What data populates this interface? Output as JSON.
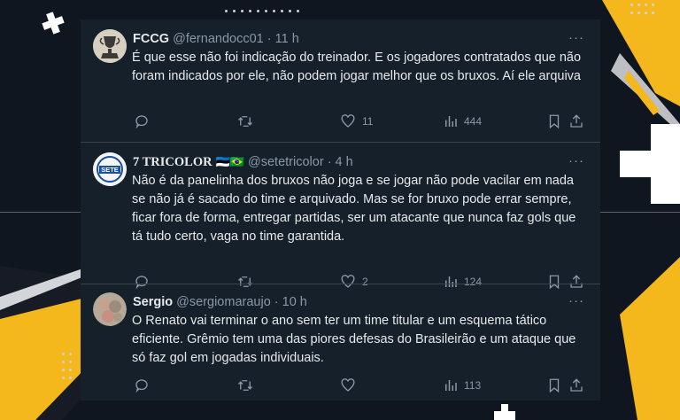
{
  "tweets": [
    {
      "display_name": "FCCG",
      "handle": "@fernandocc01",
      "time": "· 11 h",
      "text": "É que esse não foi indicação do treinador. E os jogadores contratados que não foram indicados por ele, não podem jogar melhor que os bruxos. Aí ele arquiva",
      "reply_count": "",
      "retweet_count": "",
      "like_count": "11",
      "view_count": "444",
      "avatar": "trophy-avatar"
    },
    {
      "display_name": "7 TRICOLOR",
      "flags": "🇪🇪🇧🇷",
      "handle": "@setetricolor",
      "time": "· 4 h",
      "text": "Não é da panelinha dos bruxos não joga e se jogar não pode vacilar em nada se não já é sacado do time e arquivado. Mas se for bruxo pode errar sempre, ficar fora de forma, entregar partidas, ser um atacante que nunca faz gols que tá tudo certo, vaga no time garantida.",
      "reply_count": "",
      "retweet_count": "",
      "like_count": "2",
      "view_count": "124",
      "avatar_text": "SETE"
    },
    {
      "display_name": "Sergio",
      "handle": "@sergiomaraujo",
      "time": "· 10 h",
      "text": "O Renato vai terminar o ano sem ter um time titular e um esquema tático eficiente. Grêmio tem uma das piores defesas do Brasileirão e um ataque que só faz gol em jogadas individuais.",
      "reply_count": "",
      "retweet_count": "",
      "like_count": "",
      "view_count": "113",
      "avatar": "photo-avatar"
    }
  ],
  "more_label": "···",
  "colors": {
    "panel": "#15202b",
    "accent_yellow": "#f5b81c",
    "text": "#e7e9ea",
    "muted": "#8b98a5"
  }
}
